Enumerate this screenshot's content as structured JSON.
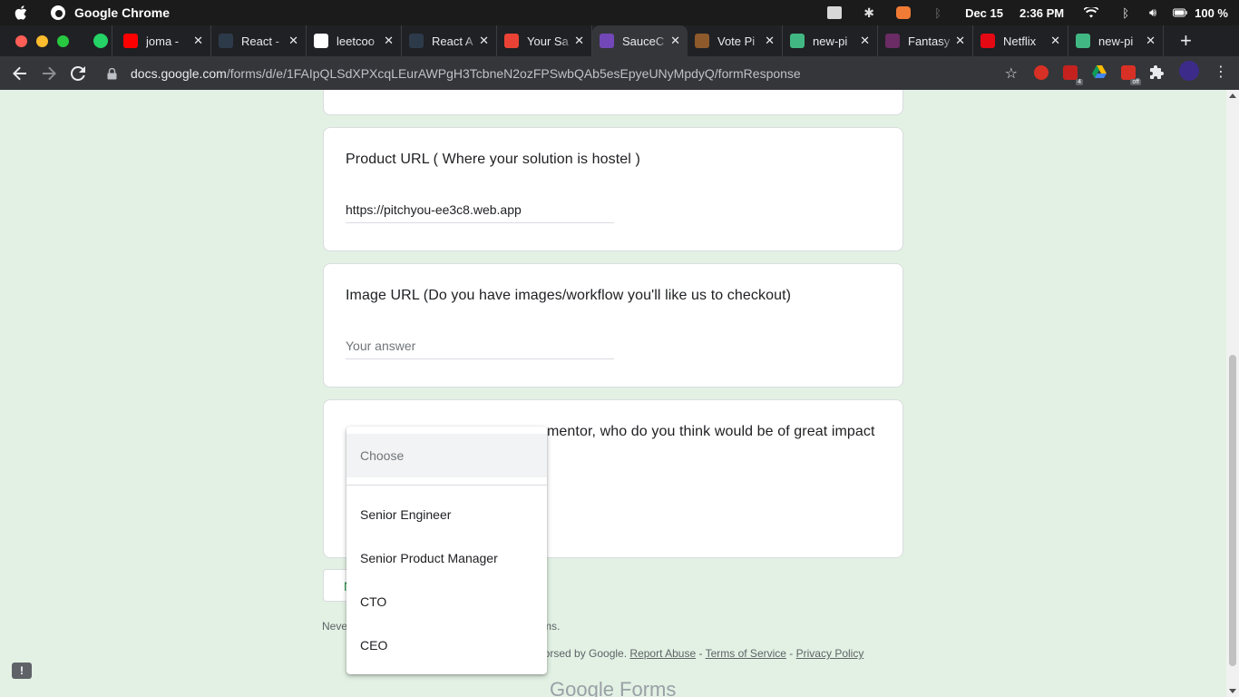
{
  "menubar": {
    "app_name": "Google Chrome",
    "date": "Dec 15",
    "time": "2:36 PM",
    "battery": "100 %"
  },
  "tabs": [
    {
      "title": "joma -",
      "fav_color": "#ff0000",
      "fav_icon": "youtube-icon"
    },
    {
      "title": "React -",
      "fav_color": "#2d3a4a",
      "fav_icon": "react-icon"
    },
    {
      "title": "leetcoo",
      "fav_color": "#ffffff",
      "fav_icon": "google-icon"
    },
    {
      "title": "React A",
      "fav_color": "#2d3a4a",
      "fav_icon": "react-icon"
    },
    {
      "title": "Your Sa",
      "fav_color": "#ea4335",
      "fav_icon": "gmail-icon"
    },
    {
      "title": "SauceC",
      "fav_color": "#7248b9",
      "fav_icon": "forms-icon"
    },
    {
      "title": "Vote Pi",
      "fav_color": "#8e5a2c",
      "fav_icon": "avatar-icon"
    },
    {
      "title": "new-pi",
      "fav_color": "#41b883",
      "fav_icon": "vue-icon"
    },
    {
      "title": "Fantasy",
      "fav_color": "#6b2b64",
      "fav_icon": "fantasy-icon"
    },
    {
      "title": "Netflix",
      "fav_color": "#e50914",
      "fav_icon": "netflix-icon"
    },
    {
      "title": "new-pi",
      "fav_color": "#41b883",
      "fav_icon": "vue-icon"
    }
  ],
  "toolbar": {
    "url_host": "docs.google.com",
    "url_path": "/forms/d/e/1FAIpQLSdXPXcqLEurAWPgH3TcbneN2ozFPSwbQAb5esEpyeUNyMpdyQ/formResponse",
    "ext_badge_1": "4",
    "ext_badge_2": "off"
  },
  "form": {
    "q_product_url": "Product URL ( Where your solution is hostel )",
    "a_product_url": "https://pitchyou-ee3c8.web.app",
    "q_image_url": "Image URL (Do you have images/workflow you'll like us to checkout)",
    "a_image_url_placeholder": "Your answer",
    "q_mentor_tail": "mentor, who do you think would be of great impact",
    "submit_label": "N",
    "footer_line1": "Neve",
    "footer_line1_tail": "rms.",
    "footer_line2_prefix": "lorsed by Google.",
    "report_abuse": "Report Abuse",
    "sep": "-",
    "terms": "Terms of Service",
    "privacy": "Privacy Policy",
    "brand": "Google Forms"
  },
  "dropdown": {
    "placeholder": "Choose",
    "options": [
      "Senior Engineer",
      "Senior Product Manager",
      "CTO",
      "CEO"
    ]
  },
  "feedback_label": "!"
}
